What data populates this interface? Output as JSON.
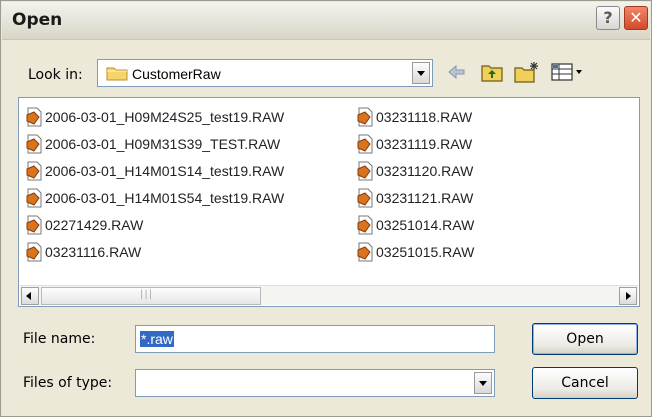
{
  "dialog": {
    "title": "Open"
  },
  "toolbar": {
    "look_in_label": "Look in:",
    "look_in_value": "CustomerRaw",
    "icons": [
      "back-arrow-icon",
      "up-folder-icon",
      "new-folder-icon",
      "views-menu-icon"
    ]
  },
  "files": {
    "column1": [
      "2006-03-01_H09M24S25_test19.RAW",
      "2006-03-01_H09M31S39_TEST.RAW",
      "2006-03-01_H14M01S14_test19.RAW",
      "2006-03-01_H14M01S54_test19.RAW",
      "02271429.RAW",
      "03231116.RAW"
    ],
    "column2": [
      "03231118.RAW",
      "03231119.RAW",
      "03231120.RAW",
      "03231121.RAW",
      "03251014.RAW",
      "03251015.RAW"
    ]
  },
  "form": {
    "file_name_label": "File name:",
    "file_name_value": "*.raw",
    "files_of_type_label": "Files of type:",
    "files_of_type_value": ""
  },
  "buttons": {
    "open": "Open",
    "cancel": "Cancel"
  },
  "colors": {
    "selection": "#316ac5",
    "close_button": "#d24a2a",
    "field_border": "#7f9db9"
  }
}
